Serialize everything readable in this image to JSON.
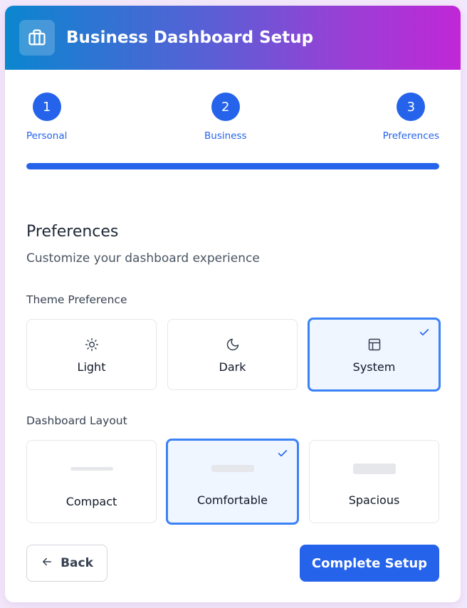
{
  "header": {
    "title": "Business Dashboard Setup",
    "icon": "briefcase-icon"
  },
  "steps": [
    {
      "number": "1",
      "label": "Personal"
    },
    {
      "number": "2",
      "label": "Business"
    },
    {
      "number": "3",
      "label": "Preferences"
    }
  ],
  "progress": {
    "percent": 100
  },
  "section": {
    "title": "Preferences",
    "subtitle": "Customize your dashboard experience"
  },
  "theme": {
    "label": "Theme Preference",
    "options": [
      {
        "label": "Light",
        "icon": "sun-icon",
        "selected": false
      },
      {
        "label": "Dark",
        "icon": "moon-icon",
        "selected": false
      },
      {
        "label": "System",
        "icon": "layout-icon",
        "selected": true
      }
    ]
  },
  "layout": {
    "label": "Dashboard Layout",
    "options": [
      {
        "label": "Compact",
        "selected": false
      },
      {
        "label": "Comfortable",
        "selected": true
      },
      {
        "label": "Spacious",
        "selected": false
      }
    ]
  },
  "actions": {
    "back_label": "Back",
    "complete_label": "Complete Setup"
  },
  "colors": {
    "accent": "#2563eb",
    "selected_border": "#3b82f6",
    "selected_bg": "#eff6ff"
  }
}
